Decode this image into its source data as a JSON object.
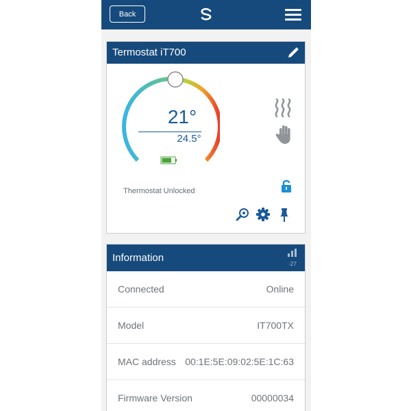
{
  "header": {
    "back_label": "Back",
    "logo_icon": "salus-logo-icon",
    "menu_icon": "hamburger-menu-icon"
  },
  "thermostat": {
    "title": "Termostat iT700",
    "set_temperature": "21°",
    "current_temperature": "24.5°",
    "battery_level": 0.75,
    "status": "Thermostat Unlocked",
    "icons": [
      "edit-icon",
      "heat-icon",
      "hand-icon",
      "unlock-icon",
      "search-icon",
      "gear-icon",
      "pin-icon"
    ]
  },
  "information": {
    "title": "Information",
    "signal_value": "-27",
    "rows": [
      {
        "label": "Connected",
        "value": "Online"
      },
      {
        "label": "Model",
        "value": "IT700TX"
      },
      {
        "label": "MAC address",
        "value": "00:1E:5E:09:02:5E:1C:63"
      },
      {
        "label": "Firmware Version",
        "value": "00000034"
      }
    ]
  },
  "colors": {
    "brand": "#174a7c",
    "accent": "#1a5a9a",
    "text_muted": "#6e7378"
  }
}
